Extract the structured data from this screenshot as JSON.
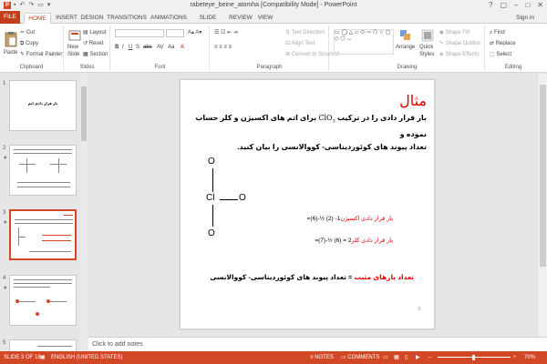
{
  "window": {
    "title": "rabeteye_beine_atomha [Compatibility Mode] - PowerPoint",
    "app_icon": "P",
    "help": "?",
    "restore": "▢",
    "minimize": "–",
    "close": "✕"
  },
  "tabs": [
    "FILE",
    "HOME",
    "INSERT",
    "DESIGN",
    "TRANSITIONS",
    "ANIMATIONS",
    "SLIDE SHOW",
    "REVIEW",
    "VIEW"
  ],
  "active_tab": "HOME",
  "sign_in": "Sign in",
  "ribbon": {
    "clipboard": {
      "label": "Clipboard",
      "paste": "Paste",
      "cut": "Cut",
      "copy": "Copy",
      "format_painter": "Format Painter"
    },
    "slides": {
      "label": "Slides",
      "new_slide": "New",
      "new_slide_2": "Slide",
      "layout": "Layout",
      "reset": "Reset",
      "section": "Section"
    },
    "font": {
      "label": "Font"
    },
    "paragraph": {
      "label": "Paragraph",
      "text_direction": "Text Direction",
      "align_text": "Align Text",
      "convert_smartart": "Convert to SmartArt"
    },
    "drawing": {
      "label": "Drawing",
      "arrange": "Arrange",
      "quick_styles": "Quick",
      "quick_styles_2": "Styles",
      "shape_fill": "Shape Fill",
      "shape_outline": "Shape Outline",
      "shape_effects": "Shape Effects"
    },
    "editing": {
      "label": "Editing",
      "find": "Find",
      "replace": "Replace",
      "select": "Select"
    }
  },
  "thumbnails": [
    {
      "num": "1",
      "title": "بار قرار دادی اتم"
    },
    {
      "num": "2",
      "star": "★"
    },
    {
      "num": "3",
      "star": "★"
    },
    {
      "num": "4",
      "star": "★"
    },
    {
      "num": "5"
    }
  ],
  "slide": {
    "title": "مثال",
    "body_line1_a": "بار قرار دادی را در ترکیب ",
    "body_formula": "ClO",
    "body_formula_sub": "3",
    "body_line1_b": " برای اتم های اکسیژن و کلر حساب نموده و",
    "body_line2": "تعداد پیوند های کوئوردیناسی- کووالانسی را بیان کنید.",
    "atoms": {
      "o_top": "O",
      "cl": "Cl",
      "o_right": "O",
      "o_bottom": "O"
    },
    "calc1_label": "بار قرار دادی اکسیژن",
    "calc1_expr": "=(6)-½ (2) -1",
    "calc2_label": "بار قرار دادی کلر",
    "calc2_expr": "=(7)-½ (6) = 2",
    "conclusion_label": "تعداد بارهای مثبت",
    "conclusion_rest": " = تعداد پیوند های کوئوردیناسی- کووالانسی",
    "slide_number": "3"
  },
  "notes_placeholder": "Click to add notes",
  "status": {
    "slide_indicator": "SLIDE 3 OF 18",
    "language": "ENGLISH (UNITED STATES)",
    "notes": "NOTES",
    "comments": "COMMENTS",
    "zoom": "70%"
  },
  "colors": {
    "accent": "#d24726",
    "title_red": "#e00000"
  }
}
